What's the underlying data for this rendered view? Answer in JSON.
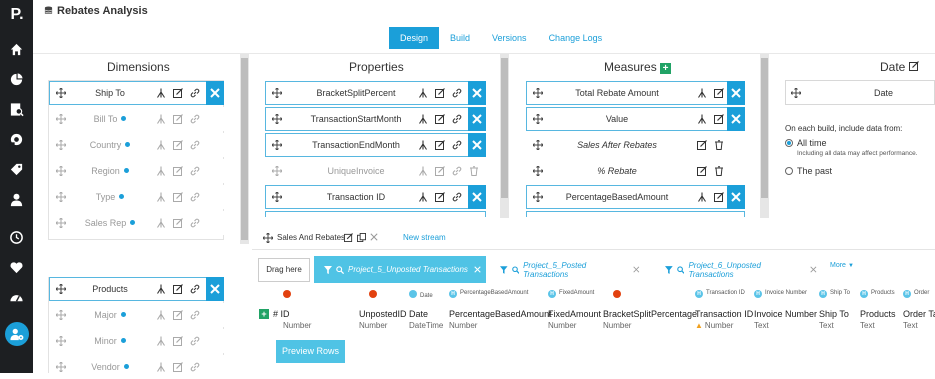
{
  "app": {
    "logo": "P.",
    "title": "Rebates Analysis"
  },
  "tabs": [
    {
      "label": "Design",
      "active": true
    },
    {
      "label": "Build"
    },
    {
      "label": "Versions"
    },
    {
      "label": "Change Logs"
    }
  ],
  "dimensions": {
    "title": "Dimensions",
    "group1": [
      "Ship To",
      "Bill To",
      "Country",
      "Region",
      "Type",
      "Sales Rep"
    ],
    "group2": [
      "Products",
      "Major",
      "Minor",
      "Vendor"
    ]
  },
  "properties": {
    "title": "Properties",
    "items": [
      "BracketSplitPercent",
      "TransactionStartMonth",
      "TransactionEndMonth",
      "UniqueInvoice",
      "Transaction ID"
    ]
  },
  "measures": {
    "title": "Measures",
    "items": [
      "Total Rebate Amount",
      "Value",
      "Sales After Rebates",
      "% Rebate",
      "PercentageBasedAmount"
    ]
  },
  "date": {
    "title": "Date",
    "field": "Date",
    "build_label": "On each build, include data from:",
    "option_all": "All time",
    "option_all_note": "Including all data may affect performance.",
    "option_past": "The past"
  },
  "streams": {
    "current": "Sales And Rebates",
    "new": "New stream"
  },
  "filters": {
    "drag": "Drag here",
    "chips": [
      "Project_5_Unposted Transactions",
      "Project_5_Posted Transactions",
      "Project_6_Unposted Transactions"
    ],
    "more": "More"
  },
  "columns": [
    {
      "badge": "",
      "name": "# ID",
      "type": "Number"
    },
    {
      "badge": "",
      "name": "UnpostedID",
      "type": "Number"
    },
    {
      "badge": "Date",
      "name": "Date",
      "type": "DateTime"
    },
    {
      "badge": "PercentageBasedAmount",
      "name": "PercentageBasedAmount",
      "type": "Number"
    },
    {
      "badge": "FixedAmount",
      "name": "FixedAmount",
      "type": "Number"
    },
    {
      "badge": "",
      "name": "BracketSplitPercentage",
      "type": "Number"
    },
    {
      "badge": "Transaction ID",
      "name": "Transaction ID",
      "type": "Number"
    },
    {
      "badge": "Invoice Number",
      "name": "Invoice Number",
      "type": "Text"
    },
    {
      "badge": "Ship To",
      "name": "Ship To",
      "type": "Text"
    },
    {
      "badge": "Products",
      "name": "Products",
      "type": "Text"
    },
    {
      "badge": "Order",
      "name": "Order Ta",
      "type": "Text"
    }
  ],
  "preview_button": "Preview Rows",
  "colors": {
    "accent": "#1b9fd9",
    "chip": "#4fc3e5",
    "sidebar": "#1d1f22",
    "warn": "#e2410f",
    "add": "#21a366"
  }
}
